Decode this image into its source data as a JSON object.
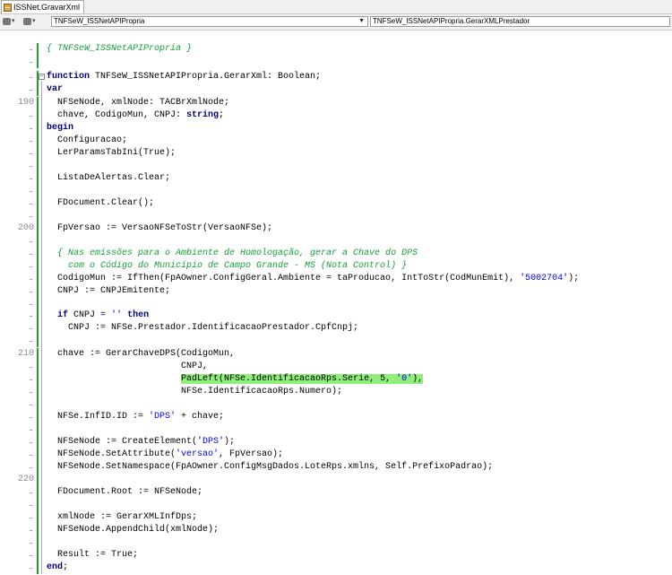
{
  "tab": {
    "label": "ISSNet.GravarXml"
  },
  "navbar": {
    "class_combo": "TNFSeW_ISSNetAPIPropria",
    "method_combo": "TNFSeW_ISSNetAPIPropria.GerarXMLPrestador"
  },
  "line_numbers": {
    "l190": "190",
    "l200": "200",
    "l210": "210",
    "l220": "220"
  },
  "code": {
    "c1_comment": "{ TNFSeW_ISSNetAPIPropria }",
    "c3_kw": "function",
    "c3_rest": " TNFSeW_ISSNetAPIPropria.GerarXml: Boolean;",
    "c4_kw": "var",
    "c5": "  NFSeNode, xmlNode: TACBrXmlNode;",
    "c6_pre": "  chave, CodigoMun, CNPJ: ",
    "c6_kw": "string",
    "c6_post": ";",
    "c7_kw": "begin",
    "c8": "  Configuracao;",
    "c9": "  LerParamsTabIni(True);",
    "c11": "  ListaDeAlertas.Clear;",
    "c13": "  FDocument.Clear();",
    "c15": "  FpVersao := VersaoNFSeToStr(VersaoNFSe);",
    "c17_comment": "  { Nas emissões para o Ambiente de Homologação, gerar a Chave do DPS",
    "c18_comment": "    com o Código do Município de Campo Grande - MS (Nota Control) }",
    "c19_pre": "  CodigoMun := IfThen(FpAOwner.ConfigGeral.Ambiente = taProducao, IntToStr(CodMunEmit), ",
    "c19_str": "'5002704'",
    "c19_post": ");",
    "c20": "  CNPJ := CNPJEmitente;",
    "c22_kw": "if",
    "c22_mid": " CNPJ = ",
    "c22_str": "''",
    "c22_kw2": "then",
    "c23": "    CNPJ := NFSe.Prestador.IdentificacaoPrestador.CpfCnpj;",
    "c25": "  chave := GerarChaveDPS(CodigoMun,",
    "c26": "                         CNPJ,",
    "c27_pre": "                         ",
    "c27_hl_a": "PadLeft(NFSe.IdentificacaoRps.Serie, 5, ",
    "c27_hl_str": "'0'",
    "c27_hl_b": "),",
    "c28": "                         NFSe.IdentificacaoRps.Numero);",
    "c30_pre": "  NFSe.InfID.ID := ",
    "c30_str": "'DPS'",
    "c30_post": " + chave;",
    "c32_pre": "  NFSeNode := CreateElement(",
    "c32_str": "'DPS'",
    "c32_post": ");",
    "c33_pre": "  NFSeNode.SetAttribute(",
    "c33_str": "'versao'",
    "c33_post": ", FpVersao);",
    "c34": "  NFSeNode.SetNamespace(FpAOwner.ConfigMsgDados.LoteRps.xmlns, Self.PrefixoPadrao);",
    "c36": "  FDocument.Root := NFSeNode;",
    "c38": "  xmlNode := GerarXMLInfDps;",
    "c39": "  NFSeNode.AppendChild(xmlNode);",
    "c41": "  Result := True;",
    "c42_kw": "end",
    "c42_post": ";"
  },
  "colors": {
    "comment": "#16a03a",
    "keyword": "#00007a",
    "string": "#0000ee",
    "highlight": "#8fef7a",
    "change_bar": "#21a035"
  }
}
